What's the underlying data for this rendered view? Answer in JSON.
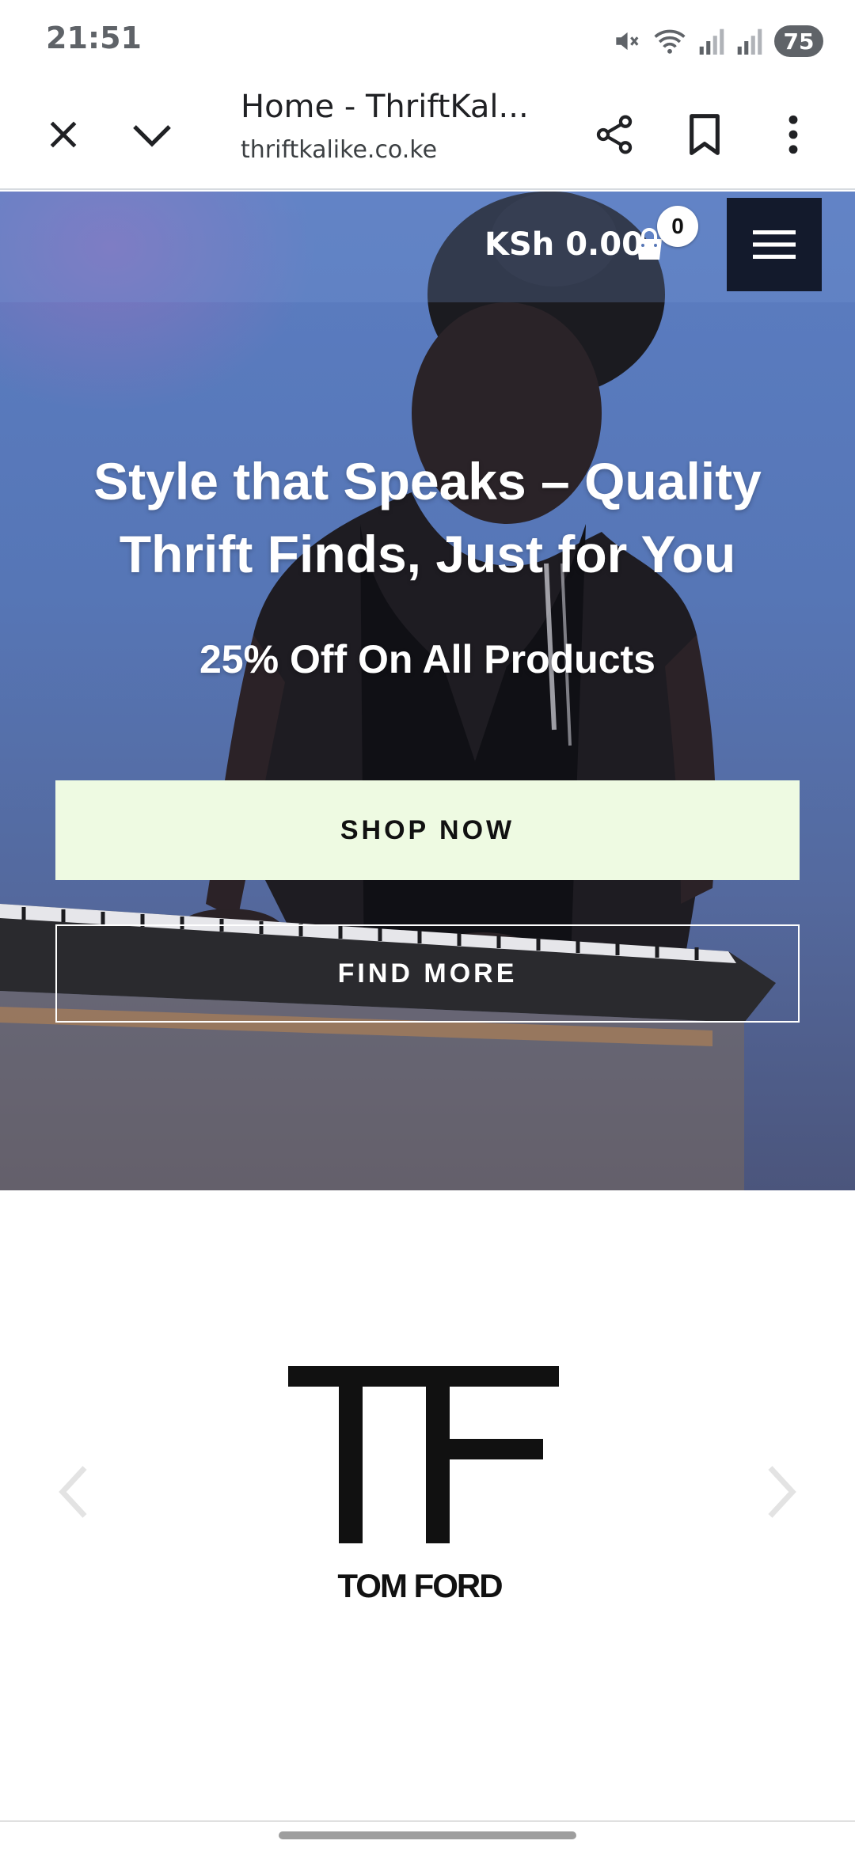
{
  "status_bar": {
    "time": "21:51",
    "battery": "75",
    "icons": [
      "mute-icon",
      "wifi-icon",
      "signal-icon",
      "signal-icon"
    ]
  },
  "browser": {
    "page_title": "Home - ThriftKal...",
    "url": "thriftkalike.co.ke",
    "icons": [
      "close-icon",
      "chevron-down-icon",
      "share-icon",
      "bookmark-icon",
      "more-vert-icon"
    ]
  },
  "header": {
    "cart_total": "KSh 0.00",
    "cart_count": "0",
    "menu_icon": "hamburger-icon"
  },
  "hero": {
    "headline": "Style that Speaks – Quality Thrift Finds, Just for You",
    "subheadline": "25% Off On All Products",
    "shop_button": "SHOP NOW",
    "find_button": "FIND MORE"
  },
  "brands": {
    "logo_mark": "TF",
    "current_brand": "TOM FORD",
    "prev_icon": "chevron-left-icon",
    "next_icon": "chevron-right-icon"
  },
  "colors": {
    "menu_button_bg": "#131a2c",
    "shop_button_bg": "#eefae2",
    "hero_bg": "#5676b6"
  }
}
